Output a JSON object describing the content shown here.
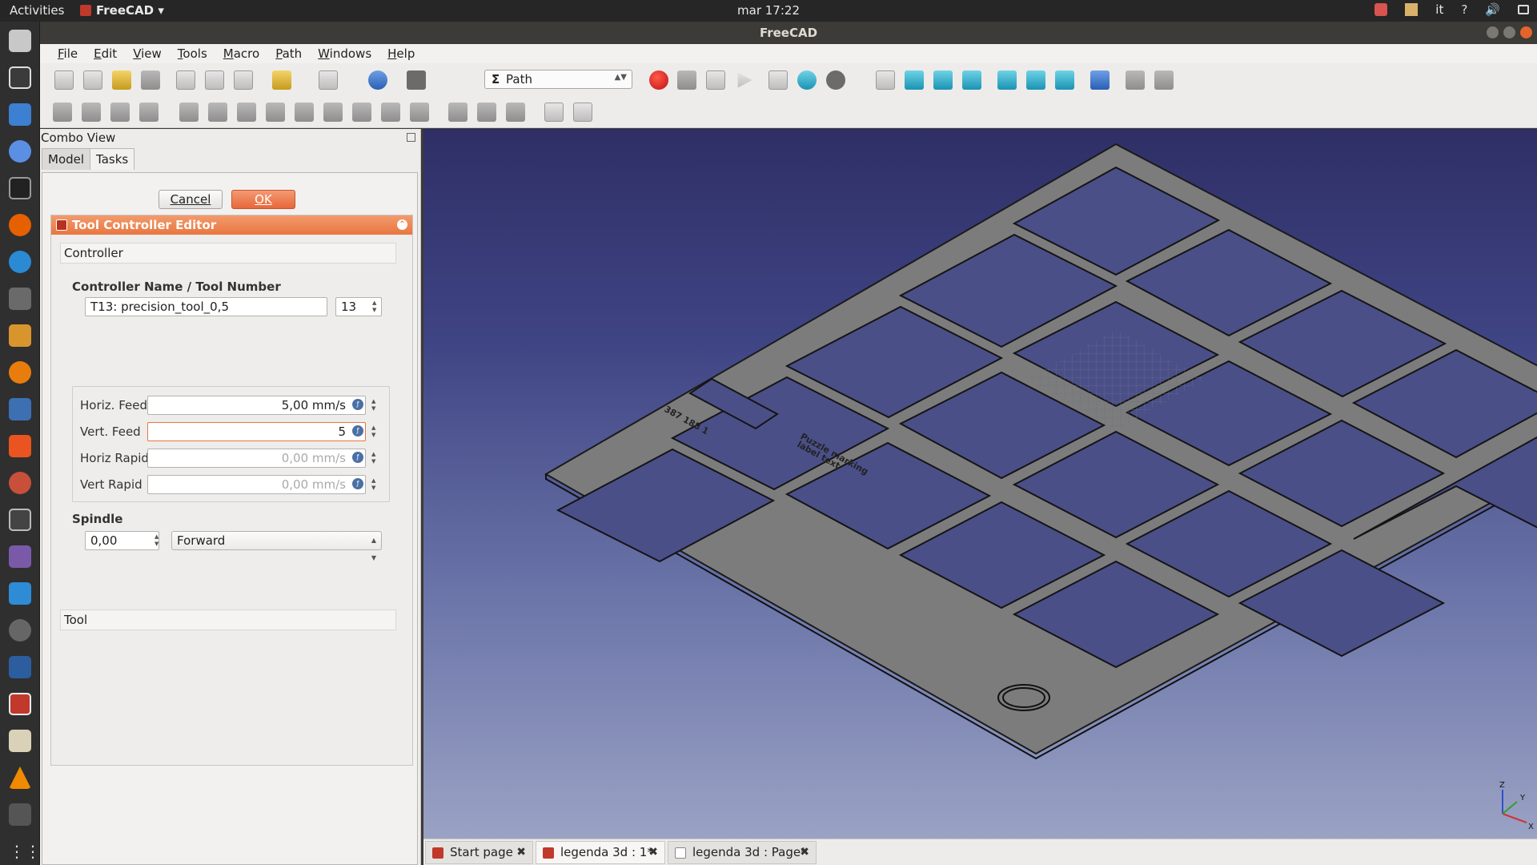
{
  "topbar": {
    "activities": "Activities",
    "app_name": "FreeCAD",
    "clock": "mar 17:22",
    "lang": "it"
  },
  "window": {
    "title": "FreeCAD"
  },
  "menu": [
    "File",
    "Edit",
    "View",
    "Tools",
    "Macro",
    "Path",
    "Windows",
    "Help"
  ],
  "toolbar": {
    "workbench": "Path"
  },
  "combo_view": {
    "title": "Combo View",
    "tabs": [
      "Model",
      "Tasks"
    ],
    "active_tab": "Tasks"
  },
  "task": {
    "cancel_label": "Cancel",
    "ok_label": "OK",
    "editor_title": "Tool Controller Editor",
    "controller_section": "Controller",
    "name_label": "Controller Name / Tool Number",
    "controller_name": "T13: precision_tool_0,5",
    "tool_number": "13",
    "horiz_feed_label": "Horiz. Feed",
    "horiz_feed": "5,00 mm/s",
    "vert_feed_label": "Vert. Feed",
    "vert_feed": "5",
    "horiz_rapid_label": "Horiz Rapid",
    "horiz_rapid": "0,00 mm/s",
    "vert_rapid_label": "Vert Rapid",
    "vert_rapid": "0,00 mm/s",
    "spindle_label": "Spindle",
    "spindle_speed": "0,00",
    "spindle_dir": "Forward",
    "tool_section": "Tool"
  },
  "view3d": {
    "axis_x": "X",
    "axis_y": "Y",
    "axis_z": "Z"
  },
  "doc_tabs": [
    {
      "label": "Start page"
    },
    {
      "label": "legenda 3d : 1*"
    },
    {
      "label": "legenda 3d : Page*"
    }
  ],
  "colors": {
    "accent": "#e9763f",
    "plate": "#7a7a7a",
    "sky_top": "#2f2f66",
    "sky_bottom": "#9aa2c4"
  }
}
